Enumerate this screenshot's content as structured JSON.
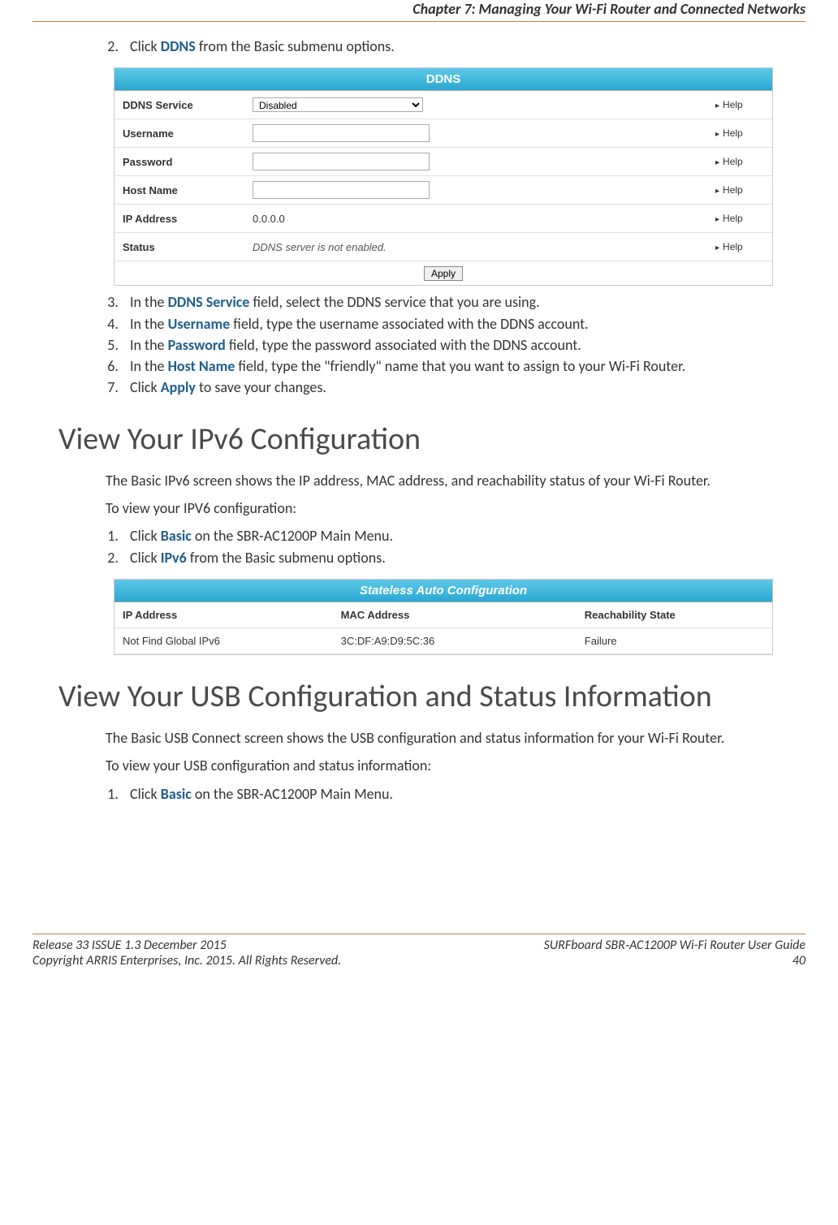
{
  "chapterTitle": "Chapter 7: Managing Your Wi-Fi Router and Connected Networks",
  "step2_pre": "Click ",
  "step2_link": "DDNS",
  "step2_post": " from the Basic submenu options.",
  "ddns": {
    "title": "DDNS",
    "rows": {
      "service_label": "DDNS Service",
      "service_value": "Disabled",
      "username_label": "Username",
      "password_label": "Password",
      "hostname_label": "Host Name",
      "ip_label": "IP Address",
      "ip_value": "0.0.0.0",
      "status_label": "Status",
      "status_value": "DDNS server is not enabled."
    },
    "help": "Help",
    "apply": "Apply"
  },
  "step3_pre": "In the ",
  "step3_bold": "DDNS Service",
  "step3_post": " field, select the DDNS service that you are using.",
  "step4_pre": "In the ",
  "step4_bold": "Username",
  "step4_post": " field, type the username associated with the DDNS account.",
  "step5_pre": "In the ",
  "step5_bold": "Password",
  "step5_post": " field, type the password associated with the DDNS account.",
  "step6_pre": "In the ",
  "step6_bold": "Host Name",
  "step6_post": " field, type the \"friendly\" name that you want to assign to your Wi-Fi Router.",
  "step7_pre": "Click ",
  "step7_bold": "Apply",
  "step7_post": " to save your changes.",
  "ipv6_heading": "View Your IPv6 Configuration",
  "ipv6_p1": "The Basic IPv6 screen shows the IP address, MAC address, and reachability status of your Wi-Fi Router.",
  "ipv6_p2": "To view your IPV6 configuration:",
  "ipv6_s1_pre": "Click ",
  "ipv6_s1_bold": "Basic",
  "ipv6_s1_post": " on the SBR-AC1200P Main Menu.",
  "ipv6_s2_pre": "Click ",
  "ipv6_s2_bold": "IPv6",
  "ipv6_s2_post": " from the Basic submenu options.",
  "stateless": {
    "title": "Stateless Auto Configuration",
    "h1": "IP Address",
    "h2": "MAC Address",
    "h3": "Reachability State",
    "c1": "Not Find Global IPv6",
    "c2": "3C:DF:A9:D9:5C:36",
    "c3": "Failure"
  },
  "usb_heading": "View Your USB Configuration and Status Information",
  "usb_p1": "The Basic USB Connect screen shows the USB configuration and status information for your Wi-Fi Router.",
  "usb_p2": "To view your USB configuration and status information:",
  "usb_s1_pre": "Click ",
  "usb_s1_bold": "Basic",
  "usb_s1_post": " on the SBR-AC1200P Main Menu.",
  "footer": {
    "release": "Release 33 ISSUE 1.3    December 2015",
    "copyright": "Copyright ARRIS Enterprises, Inc. 2015. All Rights Reserved.",
    "guide": "SURFboard SBR‑AC1200P Wi-Fi Router User Guide",
    "page": "40"
  }
}
